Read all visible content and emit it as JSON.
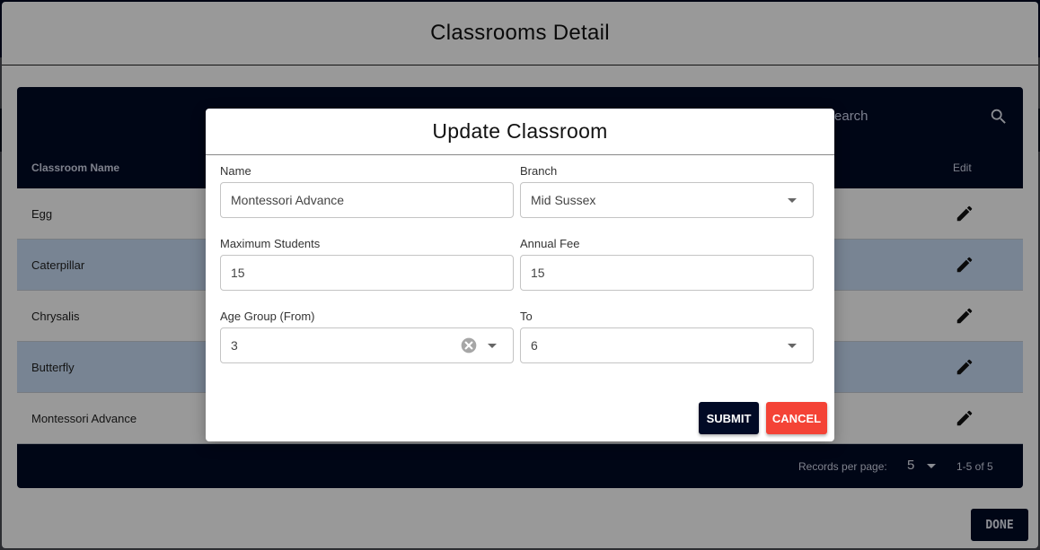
{
  "outer_dialog": {
    "title": "Classrooms Detail",
    "done_label": "DONE"
  },
  "table": {
    "search_placeholder": "Search",
    "columns": {
      "name": "Classroom Name",
      "edit": "Edit"
    },
    "rows": [
      {
        "name": "Egg"
      },
      {
        "name": "Caterpillar"
      },
      {
        "name": "Chrysalis"
      },
      {
        "name": "Butterfly"
      },
      {
        "name": "Montessori Advance"
      }
    ],
    "footer": {
      "records_per_page_label": "Records per page:",
      "records_per_page_value": "5",
      "page_range": "1-5 of 5"
    }
  },
  "modal": {
    "title": "Update Classroom",
    "fields": {
      "name": {
        "label": "Name",
        "value": "Montessori Advance"
      },
      "branch": {
        "label": "Branch",
        "value": "Mid Sussex"
      },
      "max_students": {
        "label": "Maximum Students",
        "value": "15"
      },
      "annual_fee": {
        "label": "Annual Fee",
        "value": "15"
      },
      "age_from": {
        "label": "Age Group (From)",
        "value": "3"
      },
      "age_to": {
        "label": "To",
        "value": "6"
      }
    },
    "submit_label": "SUBMIT",
    "cancel_label": "CANCEL"
  },
  "colors": {
    "navy": "#010a25",
    "cancel_red": "#f44336",
    "row_alt": "#c8ddf6"
  }
}
